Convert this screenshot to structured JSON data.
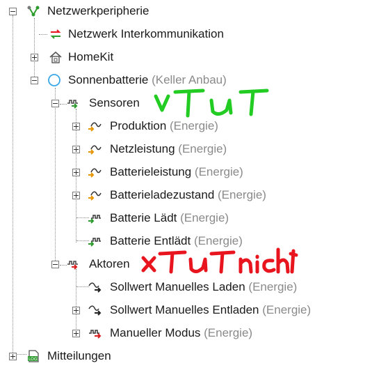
{
  "tree": {
    "netzwerk": {
      "label": "Netzwerkperipherie",
      "icon": "network-node-icon"
    },
    "interkomm": {
      "label": "Netzwerk Interkommunikation",
      "icon": "swap-arrows-icon"
    },
    "homekit": {
      "label": "HomeKit",
      "icon": "home-icon"
    },
    "sonnen": {
      "label": "Sonnenbatterie",
      "sub": "(Keller Anbau)",
      "icon": "circle-device-icon"
    },
    "sensoren": {
      "label": "Sensoren",
      "icon": "sensor-folder-icon"
    },
    "produktion": {
      "label": "Produktion",
      "sub": "(Energie)",
      "icon": "analog-sensor-icon"
    },
    "netzleistung": {
      "label": "Netzleistung",
      "sub": "(Energie)",
      "icon": "analog-sensor-icon"
    },
    "batterieleistung": {
      "label": "Batterieleistung",
      "sub": "(Energie)",
      "icon": "analog-sensor-icon"
    },
    "batterieladezustand": {
      "label": "Batterieladezustand",
      "sub": "(Energie)",
      "icon": "analog-sensor-icon"
    },
    "laedt": {
      "label": "Batterie Lädt",
      "sub": "(Energie)",
      "icon": "digital-sensor-icon"
    },
    "entlaedt": {
      "label": "Batterie Entlädt",
      "sub": "(Energie)",
      "icon": "digital-sensor-icon"
    },
    "aktoren": {
      "label": "Aktoren",
      "icon": "actuator-folder-icon"
    },
    "sollwert_laden": {
      "label": "Sollwert Manuelles Laden",
      "sub": "(Energie)",
      "icon": "analog-actuator-icon"
    },
    "sollwert_entladen": {
      "label": "Sollwert Manuelles Entladen",
      "sub": "(Energie)",
      "icon": "analog-actuator-icon"
    },
    "modus": {
      "label": "Manueller Modus",
      "sub": "(Energie)",
      "icon": "digital-actuator-icon"
    },
    "mitteilungen": {
      "label": "Mitteilungen",
      "icon": "log-icon"
    }
  },
  "annotations": {
    "works": "vTut",
    "not_works": "xTut nicht"
  },
  "colors": {
    "green_annotation": "#22cc22",
    "red_annotation": "#e8141e",
    "sensor_green": "#2e9b2e",
    "actuator_red": "#d81e1e",
    "analog_orange": "#e69500",
    "circle_blue": "#38a8e6"
  }
}
